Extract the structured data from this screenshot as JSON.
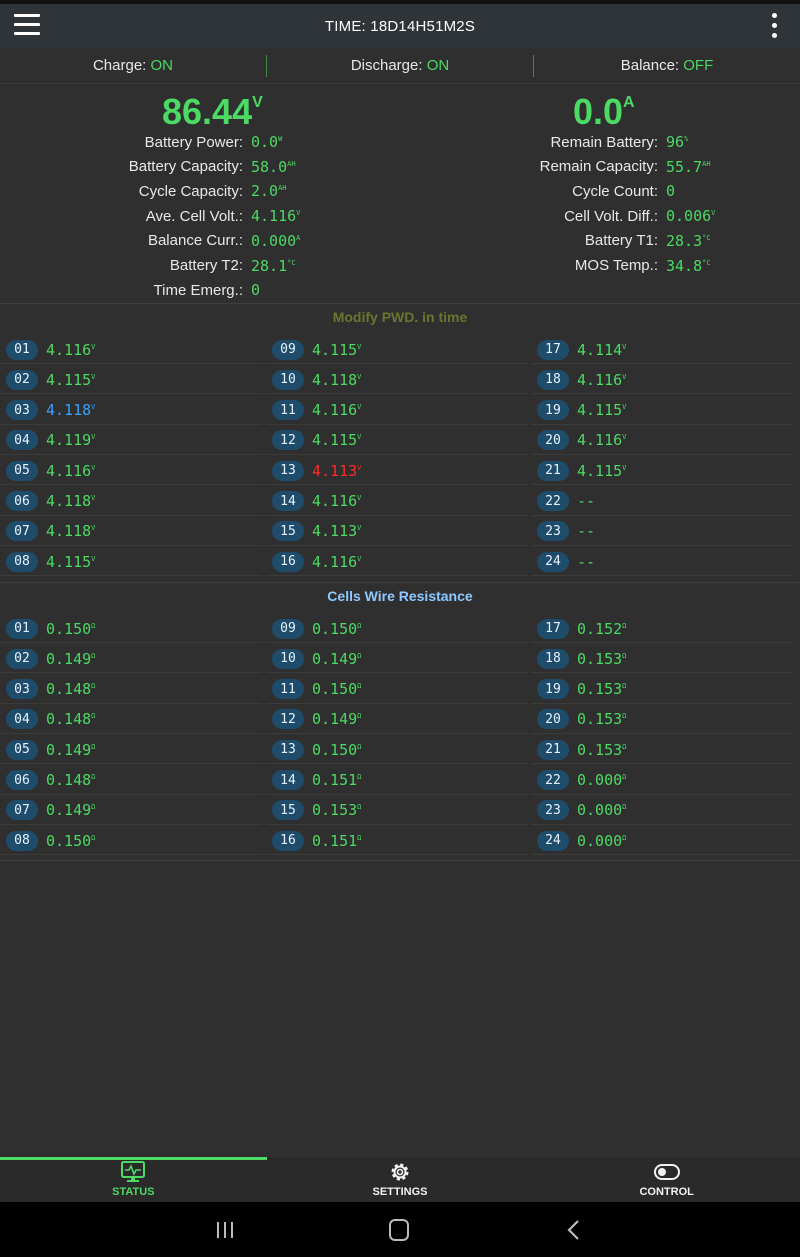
{
  "header": {
    "time_text": "TIME: 18D14H51M2S"
  },
  "switches": [
    {
      "label": "Charge:",
      "state": "ON"
    },
    {
      "label": "Discharge:",
      "state": "ON"
    },
    {
      "label": "Balance:",
      "state": "OFF"
    }
  ],
  "summary": {
    "voltage": "86.44",
    "voltage_unit": "V",
    "current": "0.0",
    "current_unit": "A",
    "left": [
      {
        "label": "Battery Power:",
        "value": "0.0",
        "unit": "W"
      },
      {
        "label": "Battery Capacity:",
        "value": "58.0",
        "unit": "AH"
      },
      {
        "label": "Cycle Capacity:",
        "value": "2.0",
        "unit": "AH"
      },
      {
        "label": "Ave. Cell Volt.:",
        "value": "4.116",
        "unit": "V"
      },
      {
        "label": "Balance Curr.:",
        "value": "0.000",
        "unit": "A"
      },
      {
        "label": "Battery T2:",
        "value": "28.1",
        "unit": "°C"
      },
      {
        "label": "Time Emerg.:",
        "value": "0",
        "unit": ""
      }
    ],
    "right": [
      {
        "label": "Remain Battery:",
        "value": "96",
        "unit": "%"
      },
      {
        "label": "Remain Capacity:",
        "value": "55.7",
        "unit": "AH"
      },
      {
        "label": "Cycle Count:",
        "value": "0",
        "unit": ""
      },
      {
        "label": "Cell Volt. Diff.:",
        "value": "0.006",
        "unit": "V"
      },
      {
        "label": "Battery T1:",
        "value": "28.3",
        "unit": "°C"
      },
      {
        "label": "MOS Temp.:",
        "value": "34.8",
        "unit": "°C"
      }
    ]
  },
  "pwd_notice": "Modify PWD. in time",
  "cell_voltages": [
    {
      "n": "01",
      "v": "4.116",
      "u": "V",
      "s": ""
    },
    {
      "n": "02",
      "v": "4.115",
      "u": "V",
      "s": ""
    },
    {
      "n": "03",
      "v": "4.118",
      "u": "V",
      "s": "hi"
    },
    {
      "n": "04",
      "v": "4.119",
      "u": "V",
      "s": ""
    },
    {
      "n": "05",
      "v": "4.116",
      "u": "V",
      "s": ""
    },
    {
      "n": "06",
      "v": "4.118",
      "u": "V",
      "s": ""
    },
    {
      "n": "07",
      "v": "4.118",
      "u": "V",
      "s": ""
    },
    {
      "n": "08",
      "v": "4.115",
      "u": "V",
      "s": ""
    },
    {
      "n": "09",
      "v": "4.115",
      "u": "V",
      "s": ""
    },
    {
      "n": "10",
      "v": "4.118",
      "u": "V",
      "s": ""
    },
    {
      "n": "11",
      "v": "4.116",
      "u": "V",
      "s": ""
    },
    {
      "n": "12",
      "v": "4.115",
      "u": "V",
      "s": ""
    },
    {
      "n": "13",
      "v": "4.113",
      "u": "V",
      "s": "lo"
    },
    {
      "n": "14",
      "v": "4.116",
      "u": "V",
      "s": ""
    },
    {
      "n": "15",
      "v": "4.113",
      "u": "V",
      "s": ""
    },
    {
      "n": "16",
      "v": "4.116",
      "u": "V",
      "s": ""
    },
    {
      "n": "17",
      "v": "4.114",
      "u": "V",
      "s": ""
    },
    {
      "n": "18",
      "v": "4.116",
      "u": "V",
      "s": ""
    },
    {
      "n": "19",
      "v": "4.115",
      "u": "V",
      "s": ""
    },
    {
      "n": "20",
      "v": "4.116",
      "u": "V",
      "s": ""
    },
    {
      "n": "21",
      "v": "4.115",
      "u": "V",
      "s": ""
    },
    {
      "n": "22",
      "v": "--",
      "u": "",
      "s": ""
    },
    {
      "n": "23",
      "v": "--",
      "u": "",
      "s": ""
    },
    {
      "n": "24",
      "v": "--",
      "u": "",
      "s": ""
    }
  ],
  "resistance_title": "Cells Wire Resistance",
  "cell_resistances": [
    {
      "n": "01",
      "v": "0.150",
      "u": "Ω"
    },
    {
      "n": "02",
      "v": "0.149",
      "u": "Ω"
    },
    {
      "n": "03",
      "v": "0.148",
      "u": "Ω"
    },
    {
      "n": "04",
      "v": "0.148",
      "u": "Ω"
    },
    {
      "n": "05",
      "v": "0.149",
      "u": "Ω"
    },
    {
      "n": "06",
      "v": "0.148",
      "u": "Ω"
    },
    {
      "n": "07",
      "v": "0.149",
      "u": "Ω"
    },
    {
      "n": "08",
      "v": "0.150",
      "u": "Ω"
    },
    {
      "n": "09",
      "v": "0.150",
      "u": "Ω"
    },
    {
      "n": "10",
      "v": "0.149",
      "u": "Ω"
    },
    {
      "n": "11",
      "v": "0.150",
      "u": "Ω"
    },
    {
      "n": "12",
      "v": "0.149",
      "u": "Ω"
    },
    {
      "n": "13",
      "v": "0.150",
      "u": "Ω"
    },
    {
      "n": "14",
      "v": "0.151",
      "u": "Ω"
    },
    {
      "n": "15",
      "v": "0.153",
      "u": "Ω"
    },
    {
      "n": "16",
      "v": "0.151",
      "u": "Ω"
    },
    {
      "n": "17",
      "v": "0.152",
      "u": "Ω"
    },
    {
      "n": "18",
      "v": "0.153",
      "u": "Ω"
    },
    {
      "n": "19",
      "v": "0.153",
      "u": "Ω"
    },
    {
      "n": "20",
      "v": "0.153",
      "u": "Ω"
    },
    {
      "n": "21",
      "v": "0.153",
      "u": "Ω"
    },
    {
      "n": "22",
      "v": "0.000",
      "u": "Ω"
    },
    {
      "n": "23",
      "v": "0.000",
      "u": "Ω"
    },
    {
      "n": "24",
      "v": "0.000",
      "u": "Ω"
    }
  ],
  "bottom_nav": [
    {
      "label": "STATUS",
      "icon": "monitor-pulse-icon",
      "active": true
    },
    {
      "label": "SETTINGS",
      "icon": "gear-icon",
      "active": false
    },
    {
      "label": "CONTROL",
      "icon": "toggle-icon",
      "active": false
    }
  ],
  "colors": {
    "accent_green": "#4cd964",
    "highest_cell_blue": "#3aa0ff",
    "lowest_cell_red": "#ff2a2a",
    "badge_blue": "#1f4c6b"
  }
}
